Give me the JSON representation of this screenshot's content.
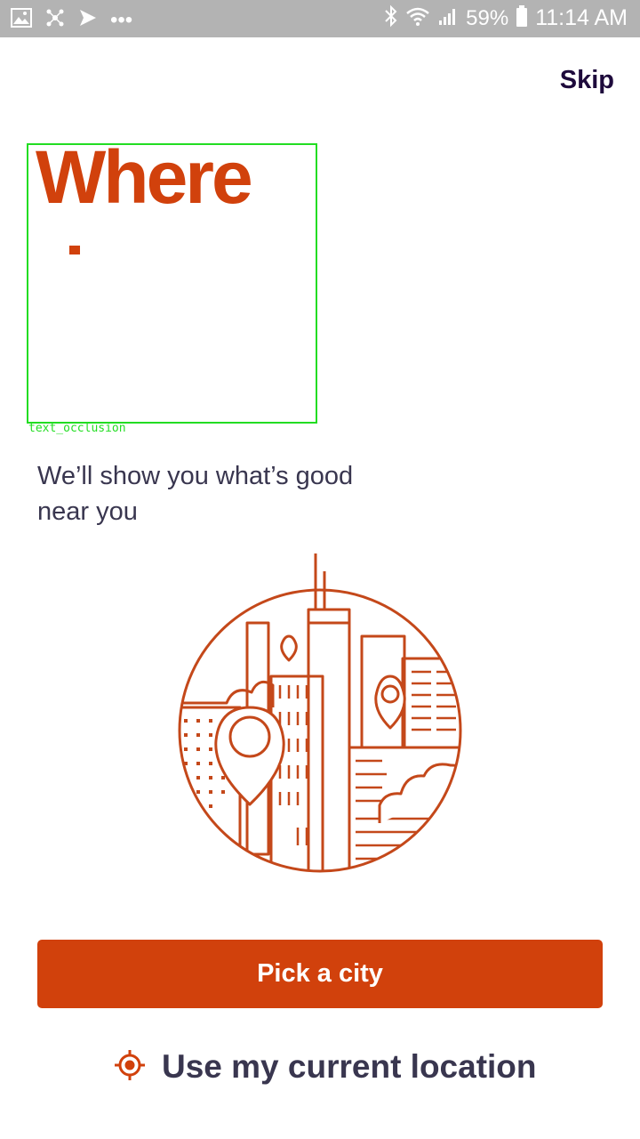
{
  "status_bar": {
    "battery": "59%",
    "time": "11:14 AM",
    "more": "•••",
    "icons": [
      "gallery-icon",
      "app-icon",
      "send-icon",
      "more-icon",
      "bluetooth-icon",
      "wifi-icon",
      "signal-icon",
      "battery-icon"
    ]
  },
  "header": {
    "skip_label": "Skip"
  },
  "onboarding": {
    "headline": "Where",
    "subtitle": "We’ll show you what’s good near you",
    "illustration": "city-illustration-icon"
  },
  "annotation": {
    "label": "text_occlusion"
  },
  "actions": {
    "pick_city_label": "Pick a city",
    "use_location_label": "Use my current location",
    "location_icon": "crosshair-icon"
  },
  "colors": {
    "accent": "#d1410c",
    "text_dark": "#1e0a3c",
    "text_body": "#39364f",
    "status_bar": "#b3b3b3",
    "annotation": "#22dd22"
  }
}
